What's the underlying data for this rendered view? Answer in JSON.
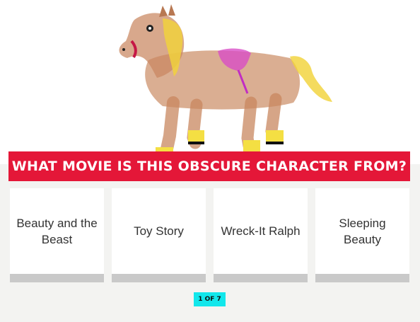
{
  "question": {
    "text": "WHAT MOVIE IS THIS OBSCURE CHARACTER FROM?"
  },
  "answers": [
    {
      "label": "Beauty and the Beast"
    },
    {
      "label": "Toy Story"
    },
    {
      "label": "Wreck-It Ralph"
    },
    {
      "label": "Sleeping Beauty"
    }
  ],
  "progress": {
    "label": "1 OF 7"
  },
  "image": {
    "subject": "horse-drawing"
  },
  "colors": {
    "banner": "#e41738",
    "badge": "#12e7eb",
    "card_bar": "#c9c9c9",
    "background": "#f3f3f1"
  }
}
